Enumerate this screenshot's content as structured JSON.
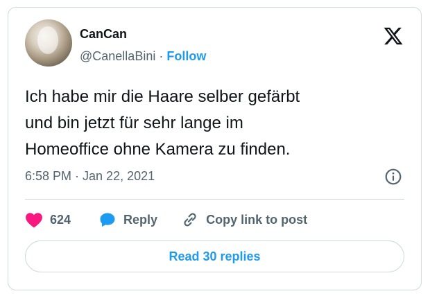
{
  "author": {
    "name": "CanCan",
    "handle": "@CanellaBini",
    "separator": "·",
    "follow_label": "Follow"
  },
  "tweet": {
    "text": "Ich habe mir die Haare selber gefärbt\nund bin jetzt für sehr lange im\nHomeoffice ohne Kamera zu finden.",
    "timestamp": "6:58 PM · Jan 22, 2021"
  },
  "actions": {
    "likes_count": "624",
    "reply_label": "Reply",
    "copy_link_label": "Copy link to post"
  },
  "footer": {
    "read_replies_label": "Read 30 replies"
  },
  "icons": {
    "logo": "x-logo-icon",
    "avatar": "avatar",
    "info": "info-icon",
    "like": "heart-icon",
    "reply": "speech-bubble-icon",
    "copy": "link-icon"
  },
  "colors": {
    "accent": "#1d9bf0",
    "heart": "#f91880",
    "text": "#0f1419",
    "secondary": "#536471",
    "border": "#cfd9de"
  }
}
